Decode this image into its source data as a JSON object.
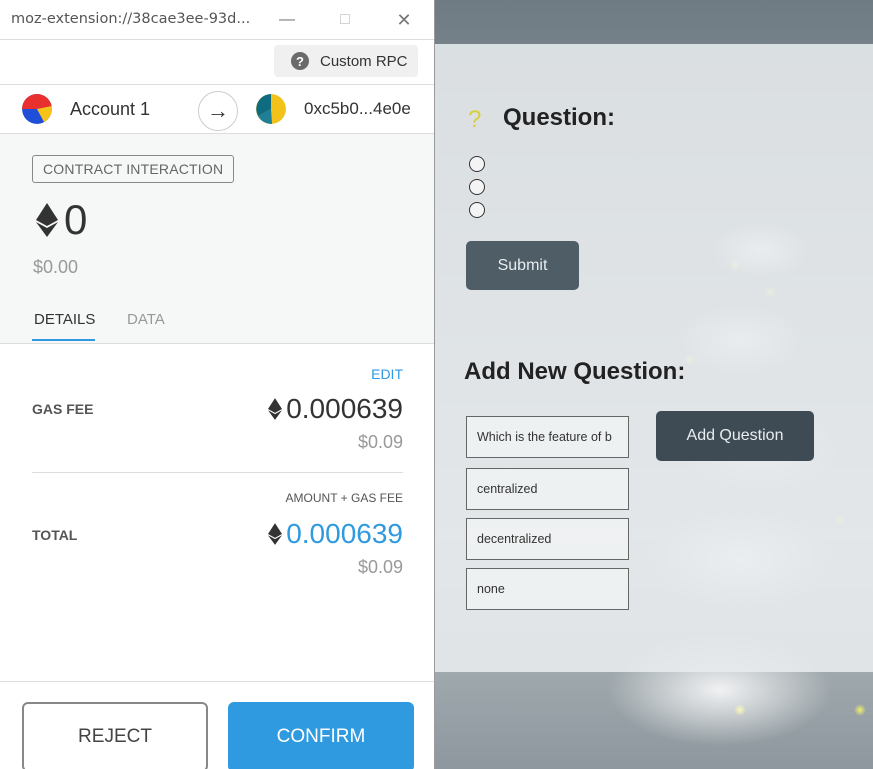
{
  "popup": {
    "url": "moz-extension://38cae3ee-93d...",
    "window_controls": {
      "minimize": "—",
      "maximize": "□",
      "close": "✕"
    },
    "network_label": "Custom RPC",
    "from_account": "Account 1",
    "to_address": "0xc5b0...4e0e",
    "badge": "CONTRACT INTERACTION",
    "amount": "0",
    "amount_fiat": "$0.00",
    "tabs": [
      "DETAILS",
      "DATA"
    ],
    "edit_label": "EDIT",
    "gas_fee_label": "GAS FEE",
    "gas_fee_eth": "0.000639",
    "gas_fee_fiat": "$0.09",
    "amount_gas_label": "AMOUNT + GAS FEE",
    "total_label": "TOTAL",
    "total_eth": "0.000639",
    "total_fiat": "$0.09",
    "reject_label": "REJECT",
    "confirm_label": "CONFIRM",
    "colors": {
      "accent": "#2f9ae0"
    }
  },
  "page": {
    "question_mark": "?",
    "question_heading": "Question:",
    "submit_label": "Submit",
    "add_heading": "Add New Question:",
    "question_input": "Which is the feature of b",
    "option_inputs": [
      "centralized",
      "decentralized",
      "none"
    ],
    "add_button": "Add Question"
  }
}
